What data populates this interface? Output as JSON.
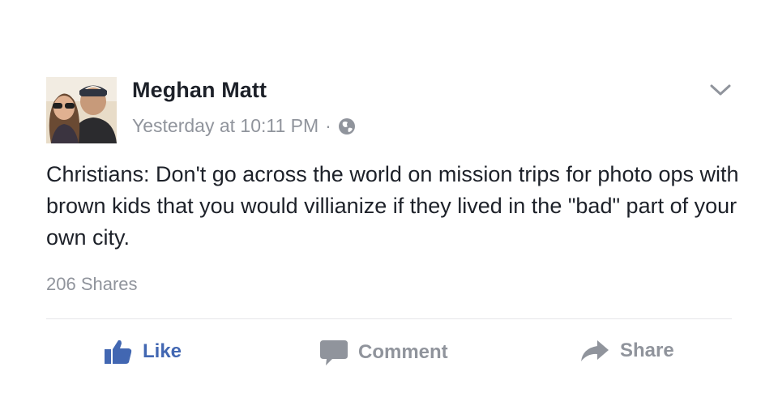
{
  "post": {
    "author": "Meghan Matt",
    "timestamp": "Yesterday at 10:11 PM",
    "separator": "·",
    "privacy_icon": "globe-icon",
    "menu_icon": "chevron-down-icon",
    "text": "Christians: Don't go across the world on mission trips for photo ops with brown kids that you would villianize if they lived in the \"bad\" part of your own city.",
    "shares": "206 Shares"
  },
  "actions": {
    "like_label": "Like",
    "comment_label": "Comment",
    "share_label": "Share"
  },
  "colors": {
    "like_blue": "#4267b2",
    "muted_gray": "#90949c",
    "text_dark": "#1d2129",
    "divider": "#e5e6e9"
  }
}
